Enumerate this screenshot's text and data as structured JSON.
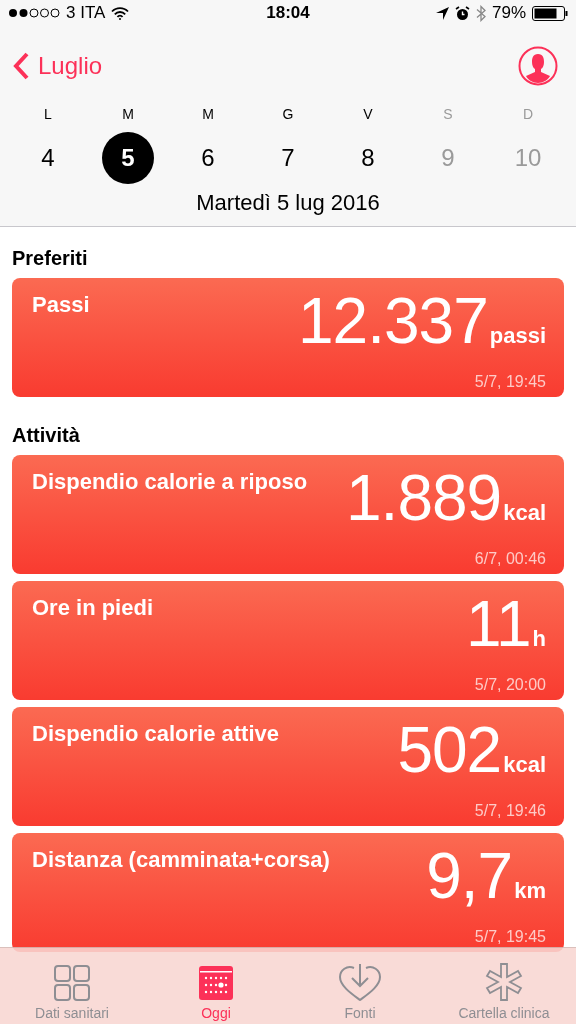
{
  "status_bar": {
    "carrier": "3 ITA",
    "time": "18:04",
    "battery": "79%"
  },
  "nav": {
    "back": "Luglio"
  },
  "week": [
    {
      "letter": "L",
      "day": "4",
      "selected": false,
      "future": false
    },
    {
      "letter": "M",
      "day": "5",
      "selected": true,
      "future": false
    },
    {
      "letter": "M",
      "day": "6",
      "selected": false,
      "future": false
    },
    {
      "letter": "G",
      "day": "7",
      "selected": false,
      "future": false
    },
    {
      "letter": "V",
      "day": "8",
      "selected": false,
      "future": false
    },
    {
      "letter": "S",
      "day": "9",
      "selected": false,
      "future": true
    },
    {
      "letter": "D",
      "day": "10",
      "selected": false,
      "future": true
    }
  ],
  "date": "Martedì 5 lug 2016",
  "sections": [
    {
      "title": "Preferiti",
      "cards": [
        {
          "title": "Passi",
          "value": "12.337",
          "unit": "passi",
          "time": "5/7, 19:45"
        }
      ]
    },
    {
      "title": "Attività",
      "cards": [
        {
          "title": "Dispendio calorie a riposo",
          "value": "1.889",
          "unit": "kcal",
          "time": "6/7, 00:46"
        },
        {
          "title": "Ore in piedi",
          "value": "11",
          "unit": "h",
          "time": "5/7, 20:00"
        },
        {
          "title": "Dispendio calorie attive",
          "value": "502",
          "unit": "kcal",
          "time": "5/7, 19:46"
        },
        {
          "title": "Distanza (camminata+corsa)",
          "value": "9,7",
          "unit": "km",
          "time": "5/7, 19:45"
        }
      ]
    }
  ],
  "tabs": [
    {
      "label": "Dati sanitari",
      "kind": "grid",
      "selected": false
    },
    {
      "label": "Oggi",
      "kind": "calendar",
      "selected": true
    },
    {
      "label": "Fonti",
      "kind": "heart",
      "selected": false
    },
    {
      "label": "Cartella clinica",
      "kind": "asterisk",
      "selected": false
    }
  ]
}
